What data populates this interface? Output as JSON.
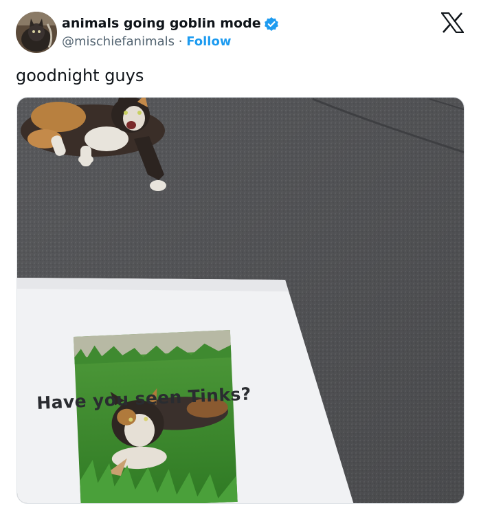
{
  "header": {
    "display_name": "animals going goblin mode",
    "handle": "@mischiefanimals",
    "separator": " · ",
    "follow_label": "Follow",
    "avatar_icon": "avatar-image",
    "verified_icon": "verified-badge-icon",
    "logo_icon": "x-logo-icon"
  },
  "tweet": {
    "text": "goodnight guys"
  },
  "media": {
    "poster_text": "Have you seen Tinks?"
  },
  "colors": {
    "link_blue": "#1d9bf0",
    "secondary_text": "#536471",
    "primary_text": "#0f1419"
  }
}
